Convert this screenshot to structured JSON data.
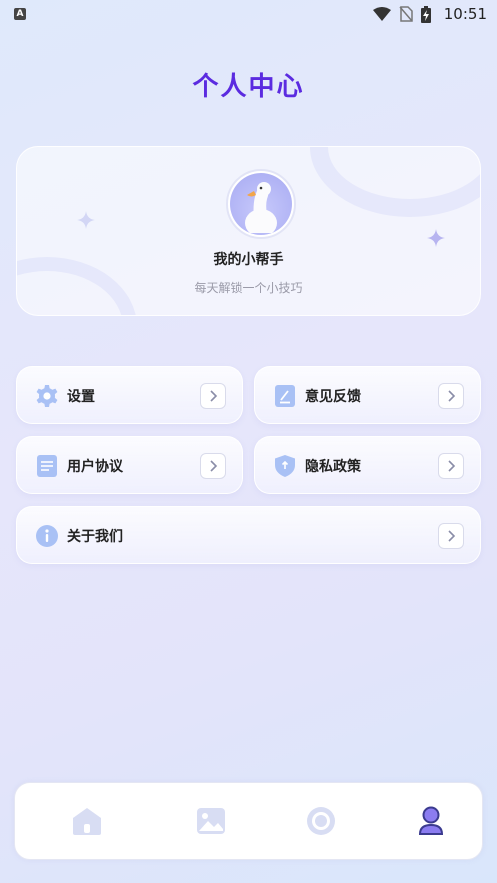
{
  "status_bar": {
    "app_badge": "A",
    "time": "10:51"
  },
  "header": {
    "title": "个人中心"
  },
  "profile": {
    "name": "我的小帮手",
    "subtitle": "每天解锁一个小技巧"
  },
  "menu": {
    "settings": "设置",
    "feedback": "意见反馈",
    "user_agreement": "用户协议",
    "privacy_policy": "隐私政策",
    "about_us": "关于我们"
  },
  "tabs": [
    {
      "icon": "home-icon",
      "active": false
    },
    {
      "icon": "image-icon",
      "active": false
    },
    {
      "icon": "record-icon",
      "active": false
    },
    {
      "icon": "profile-icon",
      "active": true
    }
  ],
  "colors": {
    "accent": "#5b2be0",
    "icon_blue": "#a9c1f5",
    "tab_inactive": "#d8ddf3",
    "tab_active": "#3b3b8f"
  }
}
